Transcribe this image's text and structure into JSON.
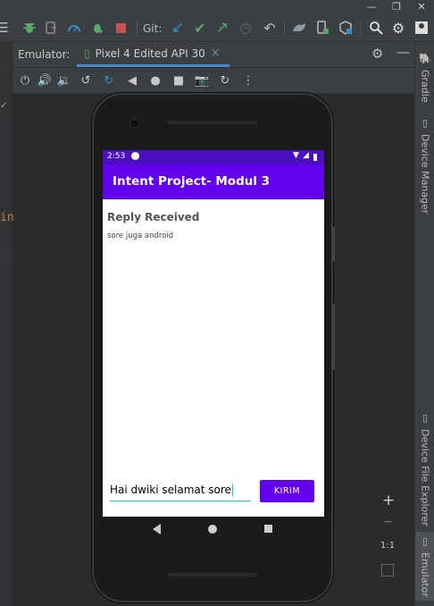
{
  "toolbar": {
    "git_label": "Git:"
  },
  "tabs": {
    "emulator_label": "Emulator:",
    "device_tab_label": "Pixel 4 Edited API 30",
    "close_glyph": "×"
  },
  "sidebar_right": {
    "gradle": "Gradle",
    "device_manager": "Device Manager",
    "device_file_explorer": "Device File Explorer",
    "emulator": "Emulator"
  },
  "editor_fragment": {
    "text": "in"
  },
  "zoom": {
    "plus": "+",
    "minus": "−",
    "ratio": "1:1"
  },
  "phone": {
    "status": {
      "time": "2:53"
    },
    "app": {
      "title": "Intent Project- Modul 3",
      "reply_header": "Reply Received",
      "reply_message": "sore juga android",
      "input_value": "Hai dwiki selamat sore",
      "send_button": "KIRIM"
    }
  },
  "colors": {
    "ide_bg": "#2b2b2b",
    "ide_panel": "#3c3f41",
    "status_bar": "#4b0fbf",
    "app_bar": "#6200ee",
    "accent_teal": "#03dac5",
    "git_check": "#59a869",
    "git_update": "#3592c4",
    "stop_red": "#c75450"
  }
}
